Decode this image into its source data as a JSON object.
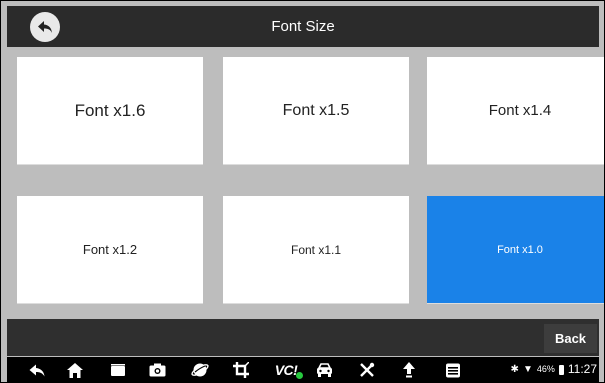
{
  "header": {
    "title": "Font Size"
  },
  "tiles": [
    {
      "label": "Font x1.6",
      "selected": false
    },
    {
      "label": "Font x1.5",
      "selected": false
    },
    {
      "label": "Font x1.4",
      "selected": false
    },
    {
      "label": "Font x1.2",
      "selected": false
    },
    {
      "label": "Font x1.1",
      "selected": false
    },
    {
      "label": "Font x1.0",
      "selected": true
    }
  ],
  "actionbar": {
    "back_label": "Back"
  },
  "navbar": {
    "icons": [
      "back-arrow-icon",
      "home-icon",
      "recent-apps-icon",
      "camera-icon",
      "browser-icon",
      "crop-icon",
      "vci-icon",
      "car-icon",
      "tools-icon",
      "upload-icon",
      "menu-list-icon"
    ],
    "vci_label": "VC!"
  },
  "status": {
    "bluetooth": "✱",
    "wifi": "▼",
    "battery_percent": "46%",
    "time": "11:27"
  },
  "colors": {
    "selected_tile": "#1a82e8",
    "header": "#2b2b2b",
    "background": "#bdbdbd"
  }
}
